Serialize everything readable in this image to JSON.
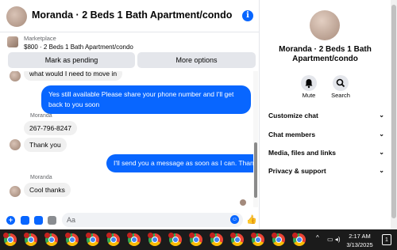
{
  "header": {
    "title": "Moranda · 2 Beds 1 Bath Apartment/condo",
    "info_icon_glyph": "i"
  },
  "marketplace": {
    "label": "Marketplace",
    "listing": "$800 · 2 Beds 1 Bath Apartment/condo",
    "buttons": {
      "pending": "Mark as pending",
      "options": "More options"
    }
  },
  "messages": {
    "partial_in": "what would I need to move in",
    "out_1": "Yes still available Please share your phone number and I'll get back to you soon",
    "sender_1": "Moranda",
    "in_phone": "267-796-8247",
    "in_thanks": "Thank you",
    "out_2": "I'll send you a message as soon as I can. Thanks",
    "sender_2": "Moranda",
    "in_cool": "Cool thanks"
  },
  "composer": {
    "placeholder": "Aa"
  },
  "side": {
    "title": "Moranda · 2 Beds 1 Bath Apartment/condo",
    "mute_label": "Mute",
    "search_label": "Search",
    "menu": [
      {
        "label": "Customize chat"
      },
      {
        "label": "Chat members"
      },
      {
        "label": "Media, files and links"
      },
      {
        "label": "Privacy & support"
      }
    ]
  },
  "taskbar": {
    "time": "2:17 AM",
    "date": "3/13/2025",
    "notification_count": "1",
    "tray_up_glyph": "^"
  },
  "colors": {
    "messenger_blue": "#0866ff",
    "bubble_gray": "#f0f0f0",
    "taskbar_bg": "#1b1b1b"
  },
  "icons": [
    "info-icon",
    "mute-bell-icon",
    "search-icon",
    "plus-icon",
    "photo-icon",
    "sticker-icon",
    "gif-icon",
    "emoji-icon",
    "like-icon",
    "chrome-icon",
    "chevron-down-icon",
    "network-icon",
    "volume-icon",
    "notification-icon"
  ]
}
